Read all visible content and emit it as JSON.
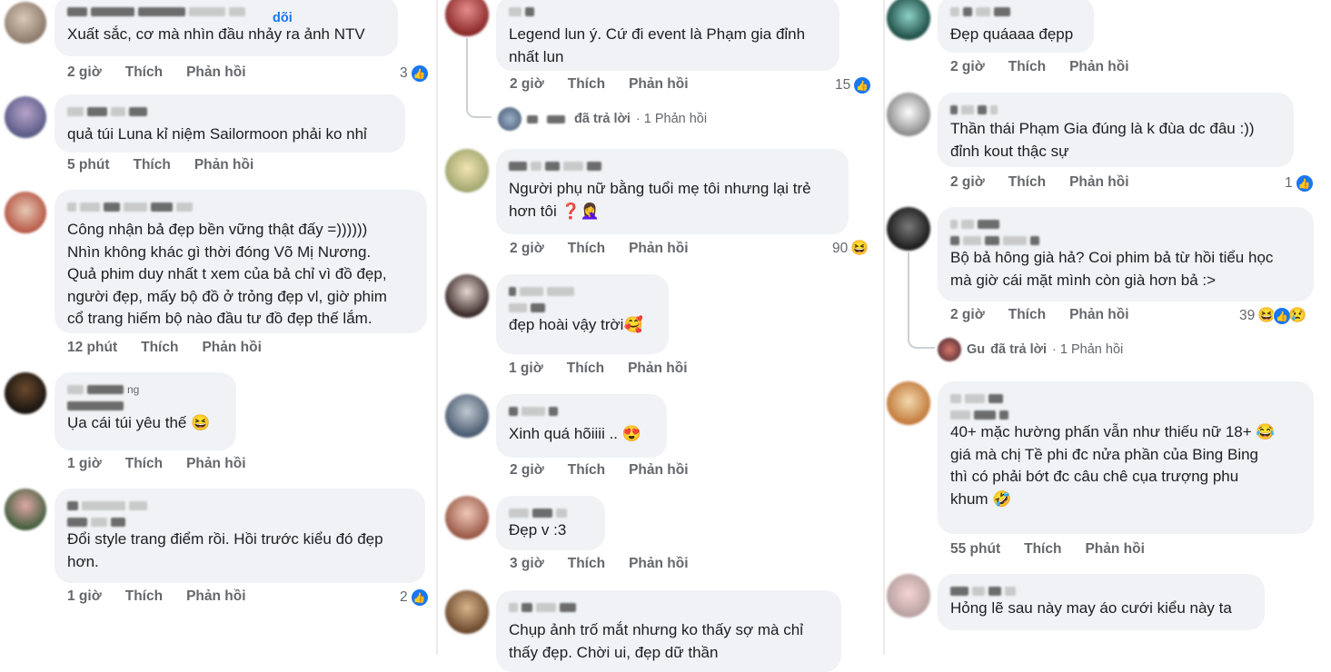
{
  "actions": {
    "like": "Thích",
    "reply": "Phản hồi"
  },
  "col1": [
    {
      "text": "Xuất sắc, cơ mà nhìn đầu nhảy ra ảnh NTV",
      "time": "2 giờ",
      "count": "3",
      "follow": "dõi"
    },
    {
      "text": "quả túi Luna kỉ niệm Sailormoon phải ko nhỉ",
      "time": "5 phút"
    },
    {
      "text": "Công nhận bả đẹp bền vững thật đấy =))))))\nNhìn không khác gì thời đóng Võ Mị Nương.\nQuả phim duy nhất t xem của bả chỉ vì đồ đẹp,\nngười đẹp, mấy bộ đồ ở trỏng đẹp vl, giờ phim\ncổ trang hiếm bộ nào đầu tư đồ đẹp thế lắm.",
      "time": "12 phút"
    },
    {
      "text": "Ụa cái túi yêu thế 😆",
      "time": "1 giờ",
      "name_suffix": "ng"
    },
    {
      "text": "Đổi style trang điểm rồi. Hồi trước kiểu đó đẹp\nhơn.",
      "time": "1 giờ",
      "count": "2"
    }
  ],
  "col2": [
    {
      "text": "Legend lun ý. Cứ đi event là Phạm gia đỉnh\nnhất lun",
      "time": "2 giờ",
      "count": "15",
      "replied_label": "đã trả lời",
      "replied_count": "· 1 Phản hồi"
    },
    {
      "text": "Người phụ nữ bằng tuổi mẹ tôi nhưng lại trẻ\nhơn tôi ❓🤦‍♀️",
      "time": "2 giờ",
      "count": "90"
    },
    {
      "text": "đẹp hoài vậy trời🥰",
      "time": "1 giờ"
    },
    {
      "text": "Xinh quá hõiiii .. 😍",
      "time": "2 giờ"
    },
    {
      "text": "Đẹp v :3",
      "time": "3 giờ"
    },
    {
      "text": "Chụp ảnh trố mắt nhưng ko thấy sợ mà chỉ\nthấy đẹp. Chời ui, đẹp dữ thần",
      "time": ""
    }
  ],
  "col3": [
    {
      "text": "Đẹp quáaaa đẹpp",
      "time": "2 giờ"
    },
    {
      "text": "Thần thái Phạm Gia đúng là k đùa dc đâu :))\nđỉnh kout thậc sự",
      "time": "2 giờ",
      "count": "1"
    },
    {
      "text": "Bộ bả hông già hả? Coi phim bả từ hồi tiểu học\nmà giờ cái mặt mình còn già hơn bả :>",
      "time": "2 giờ",
      "count": "39",
      "replied_name": "Gu",
      "replied_label": "đã trả lời",
      "replied_count": "· 1 Phản hồi"
    },
    {
      "text": "40+ mặc hường phấn vẫn như thiếu nữ 18+ 😂\ngiá mà chị Tề phi đc nửa phần của Bing Bing\nthì có phải bớt đc câu chê cụa trượng phu\nkhum 🤣",
      "time": "55 phút"
    },
    {
      "text": "Hỏng lẽ sau này may áo cưới kiểu này ta",
      "time": ""
    }
  ],
  "colors": {
    "bubble": "#f0f2f5",
    "meta": "#65676b",
    "like": "#1877f2"
  }
}
